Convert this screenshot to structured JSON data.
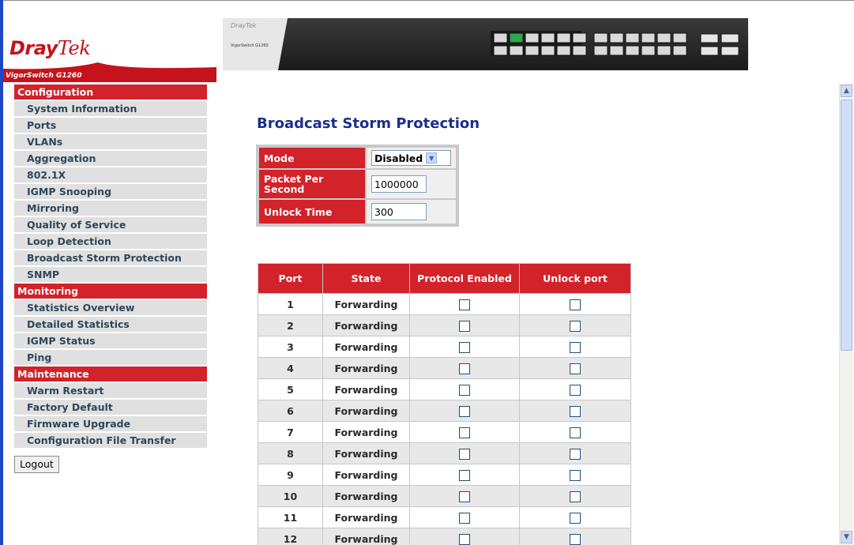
{
  "header": {
    "logo_main": "Dray",
    "logo_tek": "Tek",
    "model": "VigorSwitch G1260",
    "device_label": "VigorSwitch G1260",
    "device_brand": "DrayTek"
  },
  "sidebar": {
    "sections": [
      {
        "label": "Configuration",
        "items": [
          "System Information",
          "Ports",
          "VLANs",
          "Aggregation",
          "802.1X",
          "IGMP Snooping",
          "Mirroring",
          "Quality of Service",
          "Loop Detection",
          "Broadcast Storm Protection",
          "SNMP"
        ]
      },
      {
        "label": "Monitoring",
        "items": [
          "Statistics Overview",
          "Detailed Statistics",
          "IGMP Status",
          "Ping"
        ]
      },
      {
        "label": "Maintenance",
        "items": [
          "Warm Restart",
          "Factory Default",
          "Firmware Upgrade",
          "Configuration File Transfer"
        ]
      }
    ],
    "logout_label": "Logout"
  },
  "main": {
    "title": "Broadcast Storm Protection",
    "settings": {
      "mode_label": "Mode",
      "mode_value": "Disabled",
      "pps_label": "Packet Per Second",
      "pps_value": "1000000",
      "unlock_label": "Unlock Time",
      "unlock_value": "300"
    },
    "table": {
      "headers": [
        "Port",
        "State",
        "Protocol Enabled",
        "Unlock port"
      ],
      "rows": [
        {
          "port": "1",
          "state": "Forwarding"
        },
        {
          "port": "2",
          "state": "Forwarding"
        },
        {
          "port": "3",
          "state": "Forwarding"
        },
        {
          "port": "4",
          "state": "Forwarding"
        },
        {
          "port": "5",
          "state": "Forwarding"
        },
        {
          "port": "6",
          "state": "Forwarding"
        },
        {
          "port": "7",
          "state": "Forwarding"
        },
        {
          "port": "8",
          "state": "Forwarding"
        },
        {
          "port": "9",
          "state": "Forwarding"
        },
        {
          "port": "10",
          "state": "Forwarding"
        },
        {
          "port": "11",
          "state": "Forwarding"
        },
        {
          "port": "12",
          "state": "Forwarding"
        }
      ]
    }
  },
  "colors": {
    "accent_red": "#d2222a",
    "title_blue": "#1a2f8a",
    "menu_text": "#2d4658"
  }
}
